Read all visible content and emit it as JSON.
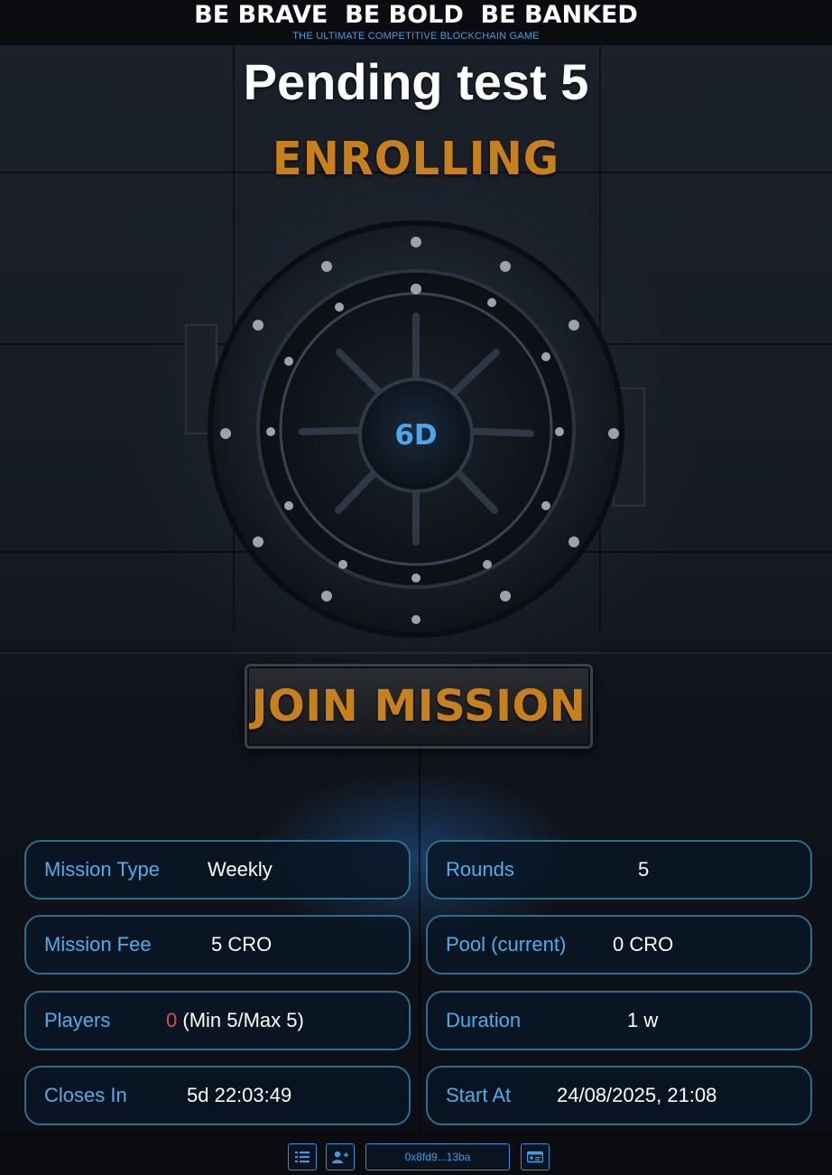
{
  "header": {
    "slogan": "BE BRAVE  BE BOLD  BE BANKED",
    "tagline": "THE ULTIMATE COMPETITIVE BLOCKCHAIN GAME"
  },
  "mission": {
    "title": "Pending test 5",
    "status": "ENROLLING",
    "vault_label": "6D",
    "join_label": "JOIN MISSION"
  },
  "details": {
    "mission_type": {
      "label": "Mission Type",
      "value": "Weekly"
    },
    "rounds": {
      "label": "Rounds",
      "value": "5"
    },
    "mission_fee": {
      "label": "Mission Fee",
      "value": "5 CRO"
    },
    "pool": {
      "label": "Pool (current)",
      "value": "0 CRO"
    },
    "players": {
      "label": "Players",
      "count": "0",
      "range": " (Min 5/Max 5)"
    },
    "duration": {
      "label": "Duration",
      "value": "1 w"
    },
    "closes_in": {
      "label": "Closes In",
      "value": "5d 22:03:49"
    },
    "start_at": {
      "label": "Start At",
      "value": "24/08/2025, 21:08"
    }
  },
  "footer": {
    "wallet_address": "0x8fd9...13ba",
    "icons": [
      "list-icon",
      "add-user-icon",
      "id-card-icon"
    ]
  },
  "colors": {
    "accent_blue": "#4faee8",
    "status_orange": "#c8801a",
    "card_border": "#2b6f8c",
    "player_count_red": "#e04a4a"
  }
}
